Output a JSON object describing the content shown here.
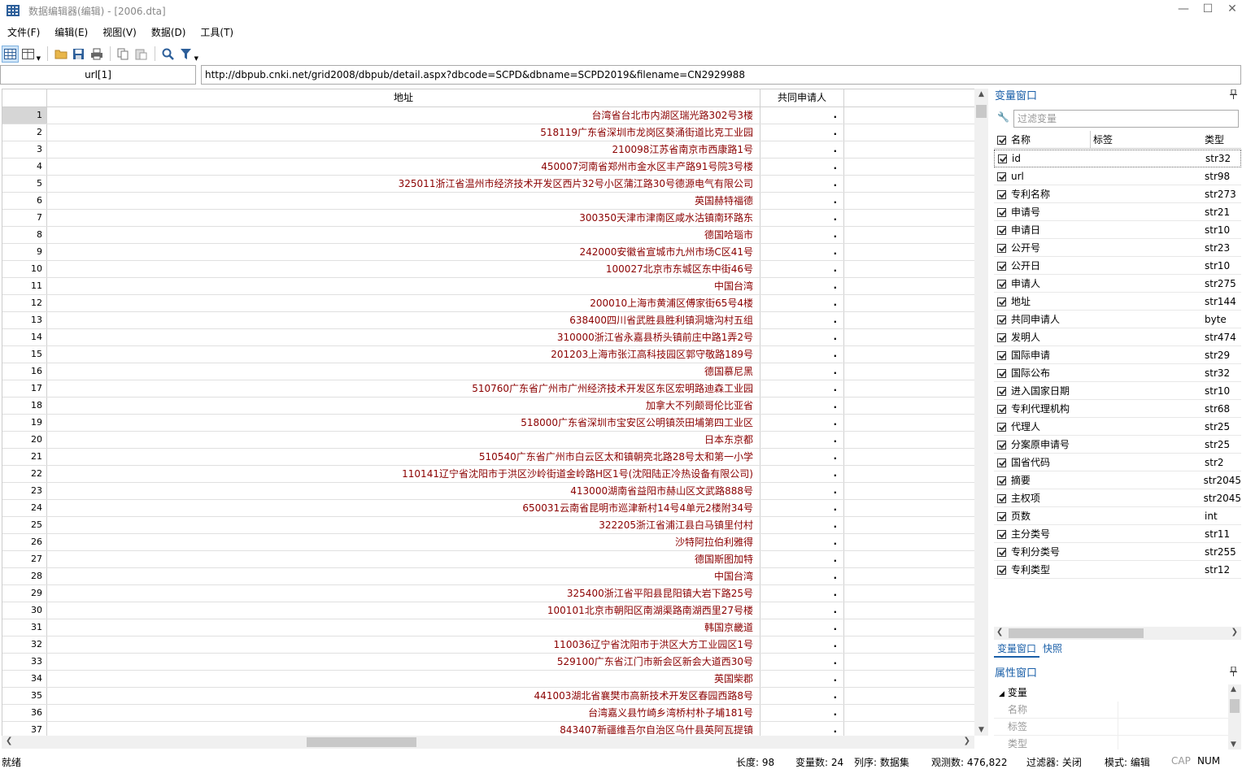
{
  "window": {
    "title": "数据编辑器(编辑) - [2006.dta]",
    "minimize": "—",
    "maximize": "☐",
    "close": "✕"
  },
  "menu": [
    "文件(F)",
    "编辑(E)",
    "视图(V)",
    "数据(D)",
    "工具(T)"
  ],
  "toolbar": {
    "icons": [
      "grid-view-icon",
      "variables-manager-icon",
      "open-folder-icon",
      "save-icon",
      "print-icon",
      "copy-icon",
      "paste-icon",
      "search-icon",
      "filter-icon"
    ]
  },
  "cellbar": {
    "cell_name": "url[1]",
    "cell_value": "http://dbpub.cnki.net/grid2008/dbpub/detail.aspx?dbcode=SCPD&dbname=SCPD2019&filename=CN2929988"
  },
  "grid": {
    "columns": [
      "地址",
      "共同申请人"
    ],
    "rows": [
      {
        "n": "1",
        "addr": "台湾省台北市内湖区瑞光路302号3楼",
        "co": "."
      },
      {
        "n": "2",
        "addr": "518119广东省深圳市龙岗区葵涌街道比克工业园",
        "co": "."
      },
      {
        "n": "3",
        "addr": "210098江苏省南京市西康路1号",
        "co": "."
      },
      {
        "n": "4",
        "addr": "450007河南省郑州市金水区丰产路91号院3号楼",
        "co": "."
      },
      {
        "n": "5",
        "addr": "325011浙江省温州市经济技术开发区西片32号小区蒲江路30号德源电气有限公司",
        "co": "."
      },
      {
        "n": "6",
        "addr": "英国赫特福德",
        "co": "."
      },
      {
        "n": "7",
        "addr": "300350天津市津南区咸水沽镇南环路东",
        "co": "."
      },
      {
        "n": "8",
        "addr": "德国哈瑙市",
        "co": "."
      },
      {
        "n": "9",
        "addr": "242000安徽省宣城市九州市场C区41号",
        "co": "."
      },
      {
        "n": "10",
        "addr": "100027北京市东城区东中街46号",
        "co": "."
      },
      {
        "n": "11",
        "addr": "中国台湾",
        "co": "."
      },
      {
        "n": "12",
        "addr": "200010上海市黄浦区傅家街65号4楼",
        "co": "."
      },
      {
        "n": "13",
        "addr": "638400四川省武胜县胜利镇洞塘沟村五组",
        "co": "."
      },
      {
        "n": "14",
        "addr": "310000浙江省永嘉县桥头镇前庄中路1弄2号",
        "co": "."
      },
      {
        "n": "15",
        "addr": "201203上海市张江高科技园区郭守敬路189号",
        "co": "."
      },
      {
        "n": "16",
        "addr": "德国慕尼黑",
        "co": "."
      },
      {
        "n": "17",
        "addr": "510760广东省广州市广州经济技术开发区东区宏明路迪森工业园",
        "co": "."
      },
      {
        "n": "18",
        "addr": "加拿大不列颠哥伦比亚省",
        "co": "."
      },
      {
        "n": "19",
        "addr": "518000广东省深圳市宝安区公明镇茨田埔第四工业区",
        "co": "."
      },
      {
        "n": "20",
        "addr": "日本东京都",
        "co": "."
      },
      {
        "n": "21",
        "addr": "510540广东省广州市白云区太和镇朝亮北路28号太和第一小学",
        "co": "."
      },
      {
        "n": "22",
        "addr": "110141辽宁省沈阳市于洪区沙岭街道金岭路H区1号(沈阳陆正冷热设备有限公司)",
        "co": "."
      },
      {
        "n": "23",
        "addr": "413000湖南省益阳市赫山区文武路888号",
        "co": "."
      },
      {
        "n": "24",
        "addr": "650031云南省昆明市巡津新村14号4单元2楼附34号",
        "co": "."
      },
      {
        "n": "25",
        "addr": "322205浙江省浦江县白马镇里付村",
        "co": "."
      },
      {
        "n": "26",
        "addr": "沙特阿拉伯利雅得",
        "co": "."
      },
      {
        "n": "27",
        "addr": "德国斯图加特",
        "co": "."
      },
      {
        "n": "28",
        "addr": "中国台湾",
        "co": "."
      },
      {
        "n": "29",
        "addr": "325400浙江省平阳县昆阳镇大岩下路25号",
        "co": "."
      },
      {
        "n": "30",
        "addr": "100101北京市朝阳区南湖渠路南湖西里27号楼",
        "co": "."
      },
      {
        "n": "31",
        "addr": "韩国京畿道",
        "co": "."
      },
      {
        "n": "32",
        "addr": "110036辽宁省沈阳市于洪区大方工业园区1号",
        "co": "."
      },
      {
        "n": "33",
        "addr": "529100广东省江门市新会区新会大道西30号",
        "co": "."
      },
      {
        "n": "34",
        "addr": "英国柴郡",
        "co": "."
      },
      {
        "n": "35",
        "addr": "441003湖北省襄樊市高新技术开发区春园西路8号",
        "co": "."
      },
      {
        "n": "36",
        "addr": "台湾嘉义县竹崎乡湾桥村朴子埔181号",
        "co": "."
      },
      {
        "n": "37",
        "addr": "843407新疆维吾尔自治区乌什县英阿瓦提镇",
        "co": "."
      }
    ]
  },
  "var_panel": {
    "title": "变量窗口",
    "pin": "📌",
    "filter_placeholder": "过滤变量",
    "headers": {
      "name": "名称",
      "label": "标签",
      "type": "类型"
    },
    "vars": [
      {
        "name": "id",
        "type": "str32"
      },
      {
        "name": "url",
        "type": "str98"
      },
      {
        "name": "专利名称",
        "type": "str273"
      },
      {
        "name": "申请号",
        "type": "str21"
      },
      {
        "name": "申请日",
        "type": "str10"
      },
      {
        "name": "公开号",
        "type": "str23"
      },
      {
        "name": "公开日",
        "type": "str10"
      },
      {
        "name": "申请人",
        "type": "str275"
      },
      {
        "name": "地址",
        "type": "str144"
      },
      {
        "name": "共同申请人",
        "type": "byte"
      },
      {
        "name": "发明人",
        "type": "str474"
      },
      {
        "name": "国际申请",
        "type": "str29"
      },
      {
        "name": "国际公布",
        "type": "str32"
      },
      {
        "name": "进入国家日期",
        "type": "str10"
      },
      {
        "name": "专利代理机构",
        "type": "str68"
      },
      {
        "name": "代理人",
        "type": "str25"
      },
      {
        "name": "分案原申请号",
        "type": "str25"
      },
      {
        "name": "国省代码",
        "type": "str2"
      },
      {
        "name": "摘要",
        "type": "str2045"
      },
      {
        "name": "主权项",
        "type": "str2045"
      },
      {
        "name": "页数",
        "type": "int"
      },
      {
        "name": "主分类号",
        "type": "str11"
      },
      {
        "name": "专利分类号",
        "type": "str255"
      },
      {
        "name": "专利类型",
        "type": "str12"
      }
    ],
    "tabs": [
      "变量窗口",
      "快照"
    ]
  },
  "props_panel": {
    "title": "属性窗口",
    "group": "变量",
    "rows": [
      "名称",
      "标签",
      "类型"
    ]
  },
  "status": {
    "ready": "就绪",
    "length": "长度: 98",
    "varcount": "变量数: 24",
    "order": "列序: 数据集",
    "obs": "观测数: 476,822",
    "filter": "过滤器: 关闭",
    "mode": "模式: 编辑",
    "cap": "CAP",
    "num": "NUM"
  }
}
